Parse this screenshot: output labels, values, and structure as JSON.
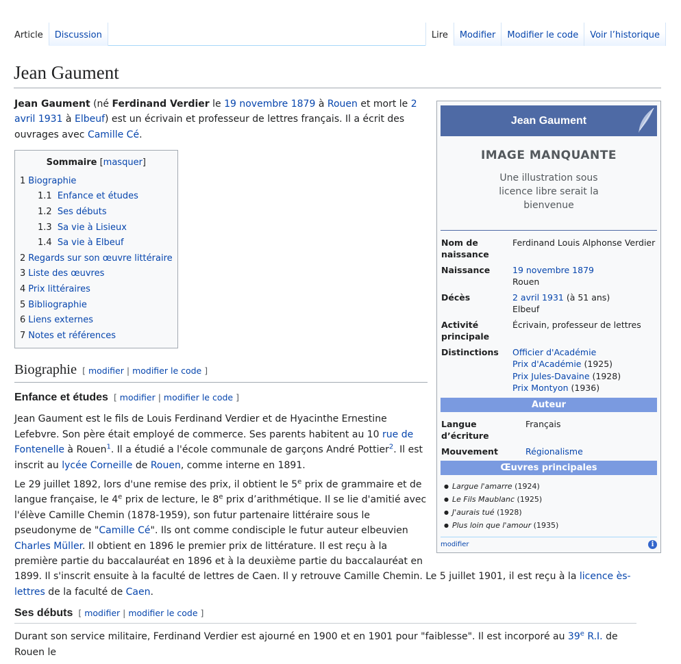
{
  "tabs": {
    "left": [
      {
        "label": "Article",
        "selected": true
      },
      {
        "label": "Discussion",
        "selected": false
      }
    ],
    "right": [
      {
        "label": "Lire",
        "selected": true
      },
      {
        "label": "Modifier",
        "selected": false
      },
      {
        "label": "Modifier le code",
        "selected": false
      },
      {
        "label": "Voir l’historique",
        "selected": false
      }
    ]
  },
  "page": {
    "title": "Jean Gaument"
  },
  "intro": {
    "name": "Jean Gaument",
    "t1": " (né ",
    "birthname": "Ferdinand Verdier",
    "t2": " le ",
    "birth_date": "19 novembre 1879",
    "t3": " à ",
    "birth_place": "Rouen",
    "t4": " et mort le ",
    "death_date": "2 avril 1931",
    "t5": " à ",
    "death_place": "Elbeuf",
    "t6": ") est un écrivain et professeur de lettres français. Il a écrit des ouvrages avec ",
    "coauthor": "Camille Cé",
    "t7": "."
  },
  "toc": {
    "title": "Sommaire",
    "toggle_open": "[",
    "toggle": "masquer",
    "toggle_close": "]",
    "items": [
      {
        "num": "1",
        "label": "Biographie",
        "sub": [
          {
            "num": "1.1",
            "label": "Enfance et études"
          },
          {
            "num": "1.2",
            "label": "Ses débuts"
          },
          {
            "num": "1.3",
            "label": "Sa vie à Lisieux"
          },
          {
            "num": "1.4",
            "label": "Sa vie à Elbeuf"
          }
        ]
      },
      {
        "num": "2",
        "label": "Regards sur son œuvre littéraire"
      },
      {
        "num": "3",
        "label": "Liste des œuvres"
      },
      {
        "num": "4",
        "label": "Prix littéraires"
      },
      {
        "num": "5",
        "label": "Bibliographie"
      },
      {
        "num": "6",
        "label": "Liens externes"
      },
      {
        "num": "7",
        "label": "Notes et références"
      }
    ]
  },
  "editsec": {
    "open": "[ ",
    "modifier": "modifier",
    "sep": " | ",
    "modifier_code": "modifier le code",
    "close": " ]"
  },
  "sections": {
    "biographie": "Biographie",
    "enfance": "Enfance et études",
    "debuts": "Ses débuts"
  },
  "p1": {
    "a": "Jean Gaument est le fils de Louis Ferdinand Verdier et de Hyacinthe Ernestine Lefebvre. Son père était employé de commerce. Ses parents habitent au 10 ",
    "l1": "rue de Fontenelle",
    "b": " à Rouen",
    "s1": "1",
    "c": ". Il a étudié a l'école communale de garçons André Pottier",
    "s2": "2",
    "d": ". Il est inscrit au ",
    "l2": "lycée Corneille",
    "e": " de ",
    "l3": "Rouen",
    "f": ", comme interne en 1891."
  },
  "p2": {
    "a": "Le 29 juillet 1892, lors d'une remise des prix, il obtient le 5",
    "s1": "e",
    "b": " prix de grammaire et de langue française, le 4",
    "s2": "e",
    "c": " prix de lecture, le 8",
    "s3": "e",
    "d": " prix d’arithmétique. Il se lie d'amitié avec l'élève Camille Chemin (1878-1959), son futur partenaire littéraire sous le pseudonyme de \"",
    "l1": "Camille Cé",
    "e": "\". Ils ont comme condisciple le futur auteur elbeuvien ",
    "l2": "Charles Müller",
    "f": ". Il obtient en 1896 le premier prix de littérature. Il est reçu à la première partie du baccalauréat en 1896 et à la deuxième partie du baccalauréat en 1899. Il s'inscrit ensuite à la faculté de lettres de Caen. Il y retrouve Camille Chemin. Le 5 juillet 1901, il est reçu à la ",
    "l3": "licence ès-lettres",
    "g": " de la faculté de ",
    "l4": "Caen",
    "h": "."
  },
  "p3": {
    "a": "Durant son service militaire, Ferdinand Verdier est ajourné en 1900 et en 1901 pour \"faiblesse\". Il est incorporé au ",
    "l1": "39",
    "s1": "e",
    "l1b": " R.I.",
    "b": " de Rouen le"
  },
  "infobox": {
    "title": "Jean Gaument",
    "image_missing": "IMAGE MANQUANTE",
    "image_hint": "Une illustration sous licence libre serait la bienvenue",
    "rows": [
      {
        "label": "Nom de naissance",
        "value": "Ferdinand Louis Alphonse Verdier"
      },
      {
        "label": "Naissance",
        "link": "19 novembre 1879",
        "value2": "Rouen"
      },
      {
        "label": "Décès",
        "link": "2 avril 1931",
        "extra": " (à 51 ans)",
        "value2": "Elbeuf"
      },
      {
        "label": "Activité principale",
        "value": "Écrivain, professeur de lettres"
      }
    ],
    "distinctions_label": "Distinctions",
    "distinctions": [
      {
        "link": "Officier d'Académie",
        "year": ""
      },
      {
        "link": "Prix d'Académie",
        "year": " (1925)"
      },
      {
        "link": "Prix Jules-Davaine",
        "year": " (1928)"
      },
      {
        "link": "Prix Montyon",
        "year": " (1936)"
      }
    ],
    "author_header": "Auteur",
    "lang_label": "Langue d’écriture",
    "lang_value": "Français",
    "movement_label": "Mouvement",
    "movement_value": "Régionalisme",
    "works_header": "Œuvres principales",
    "works": [
      {
        "title": "Largue l'amarre",
        "year": " (1924)"
      },
      {
        "title": "Le Fils Maublanc",
        "year": " (1925)"
      },
      {
        "title": "J'aurais tué",
        "year": " (1928)"
      },
      {
        "title": "Plus loin que l'amour",
        "year": " (1935)"
      }
    ],
    "edit": "modifier",
    "info_glyph": "i"
  },
  "colors": {
    "link": "#0645ad",
    "infobox_title": "#4e6aa5",
    "infobox_section": "#7a9ae0",
    "border": "#a2a9b1"
  }
}
